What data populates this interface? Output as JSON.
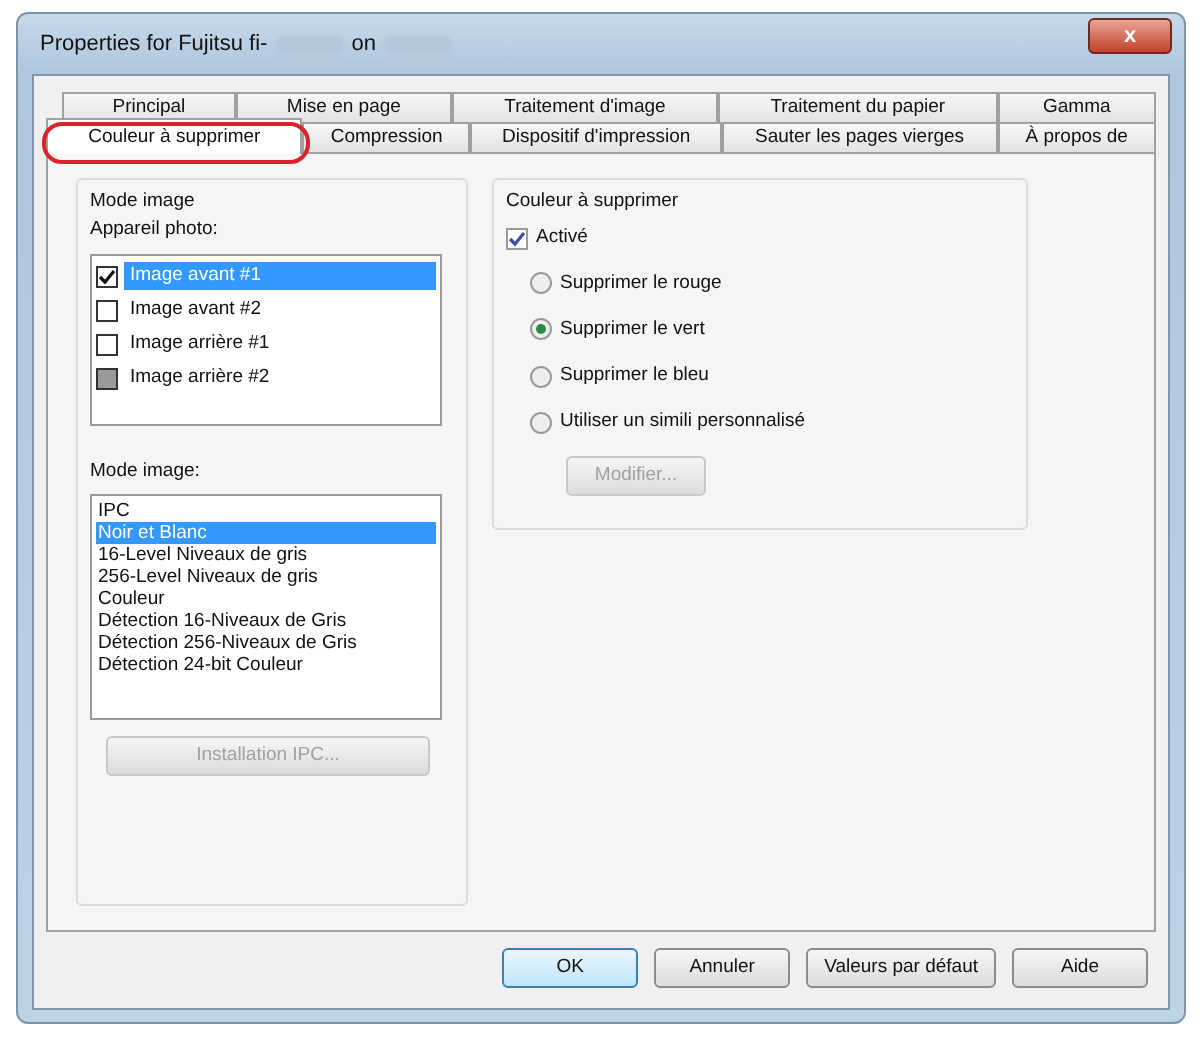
{
  "window": {
    "title_parts": [
      {
        "kind": "text",
        "text": "Properties for Fujitsu fi-"
      },
      {
        "kind": "redacted"
      },
      {
        "kind": "text",
        "text": "on"
      },
      {
        "kind": "redacted"
      }
    ],
    "close_label": "x"
  },
  "tab_rows": [
    [
      {
        "label": "Principal",
        "selected": false
      },
      {
        "label": "Mise en page",
        "selected": false
      },
      {
        "label": "Traitement d'image",
        "selected": false
      },
      {
        "label": "Traitement du papier",
        "selected": false
      },
      {
        "label": "Gamma",
        "selected": false
      }
    ],
    [
      {
        "label": "Couleur à supprimer",
        "selected": true
      },
      {
        "label": "Compression",
        "selected": false
      },
      {
        "label": "Dispositif d'impression",
        "selected": false
      },
      {
        "label": "Sauter les pages vierges",
        "selected": false
      },
      {
        "label": "À propos de",
        "selected": false
      }
    ]
  ],
  "left_group": {
    "title": "Mode image",
    "camera_label": "Appareil photo:",
    "cameras": [
      {
        "label": "Image avant #1",
        "checked": true,
        "selected": true,
        "disabled": false
      },
      {
        "label": "Image avant #2",
        "checked": false,
        "selected": false,
        "disabled": false
      },
      {
        "label": "Image arrière #1",
        "checked": false,
        "selected": false,
        "disabled": false
      },
      {
        "label": "Image arrière #2",
        "checked": false,
        "selected": false,
        "disabled": true
      }
    ],
    "mode_label": "Mode image:",
    "modes": [
      {
        "label": "IPC",
        "selected": false
      },
      {
        "label": "Noir et Blanc",
        "selected": true
      },
      {
        "label": "16-Level Niveaux de gris",
        "selected": false
      },
      {
        "label": "256-Level Niveaux de gris",
        "selected": false
      },
      {
        "label": "Couleur",
        "selected": false
      },
      {
        "label": "Détection 16-Niveaux de Gris",
        "selected": false
      },
      {
        "label": "Détection 256-Niveaux de Gris",
        "selected": false
      },
      {
        "label": "Détection 24-bit Couleur",
        "selected": false
      }
    ],
    "button": {
      "label": "Installation IPC...",
      "disabled": true
    }
  },
  "right_group": {
    "title": "Couleur à supprimer",
    "enable": {
      "label": "Activé",
      "checked": true
    },
    "options": [
      {
        "label": "Supprimer le rouge",
        "selected": false
      },
      {
        "label": "Supprimer le vert",
        "selected": true
      },
      {
        "label": "Supprimer le bleu",
        "selected": false
      },
      {
        "label": "Utiliser un simili personnalisé",
        "selected": false
      }
    ],
    "button": {
      "label": "Modifier...",
      "disabled": true
    }
  },
  "buttons": [
    {
      "label": "OK",
      "default": true
    },
    {
      "label": "Annuler",
      "default": false
    },
    {
      "label": "Valeurs par défaut",
      "default": false
    },
    {
      "label": "Aide",
      "default": false
    }
  ]
}
